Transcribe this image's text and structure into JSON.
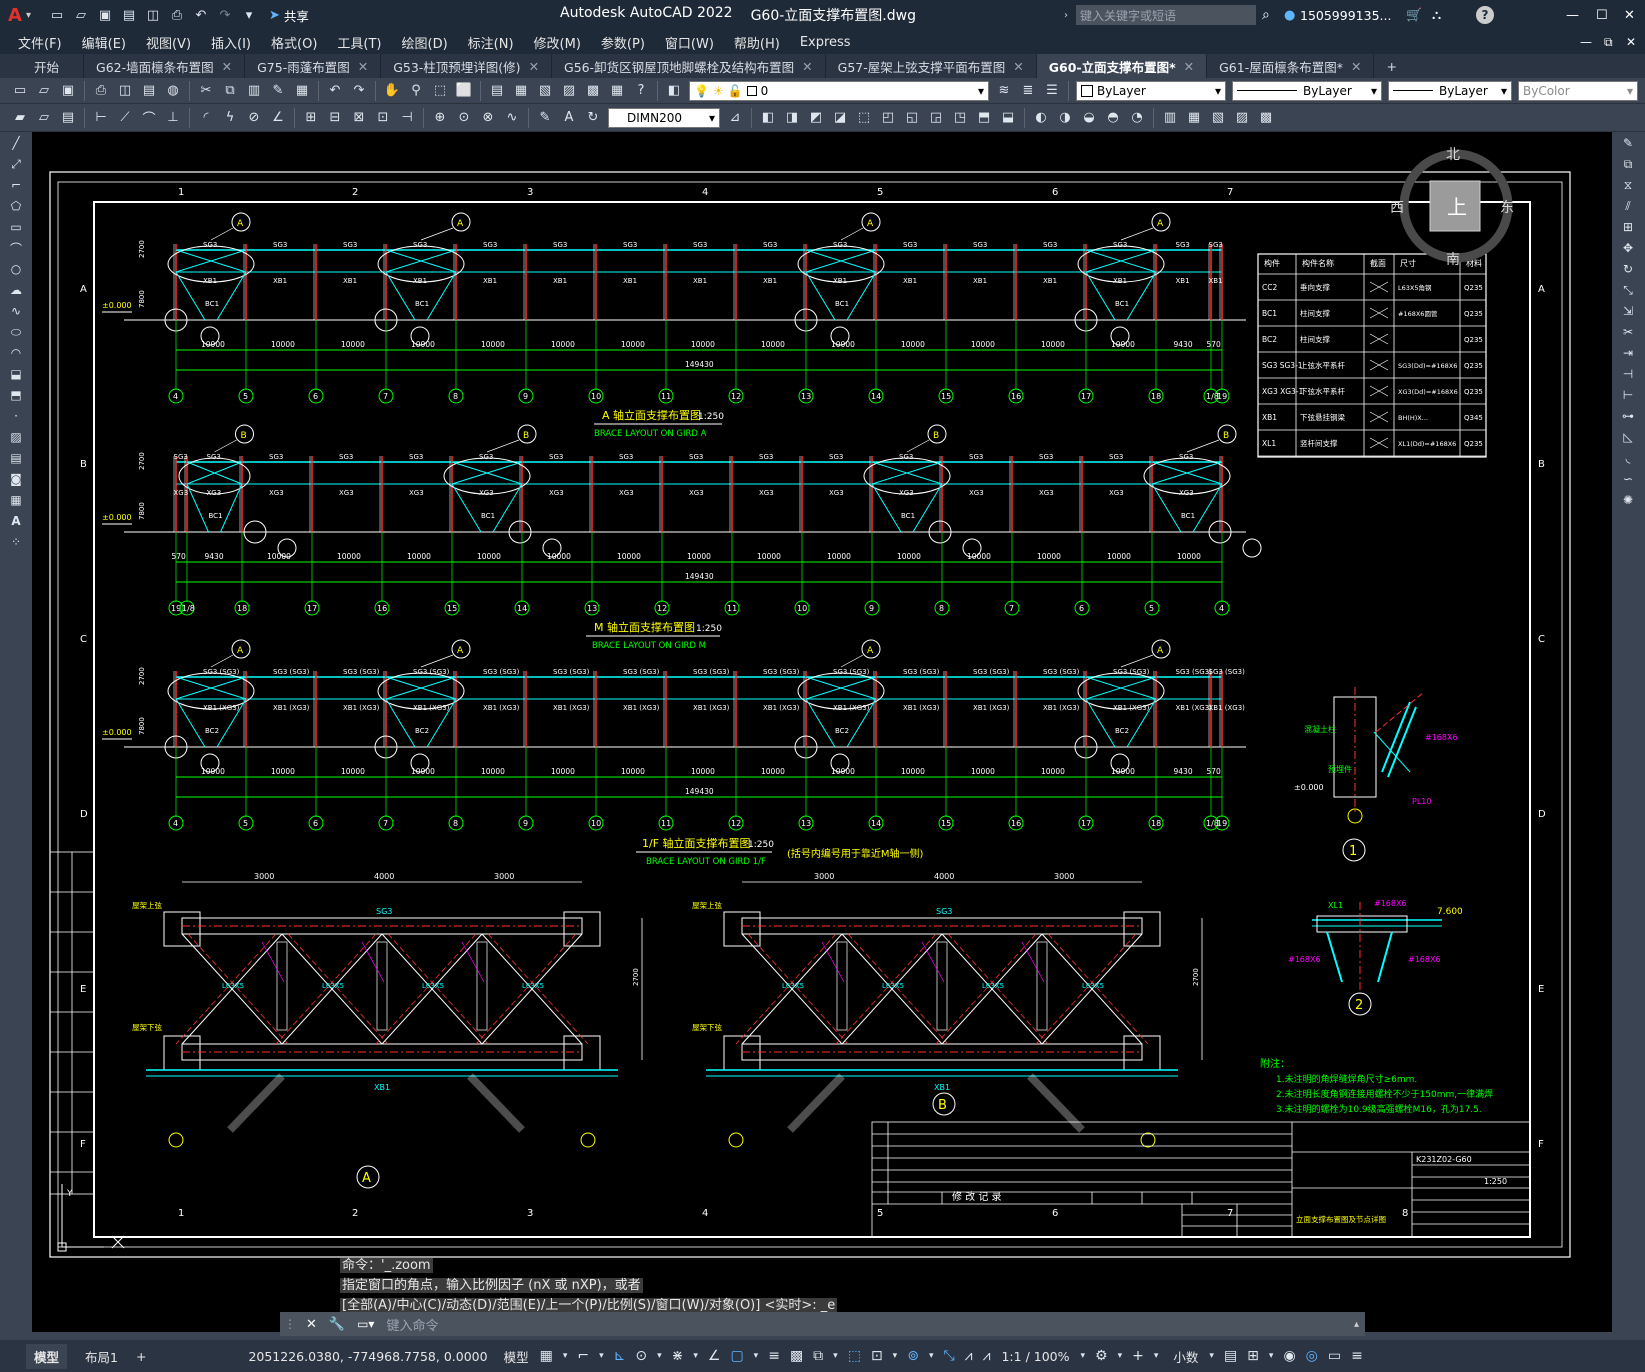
{
  "title_bar": {
    "app_title": "Autodesk AutoCAD 2022",
    "file_name": "G60-立面支撑布置图.dwg",
    "share_label": "共享",
    "search_placeholder": "键入关键字或短语",
    "user": "1505999135...",
    "logo": "A"
  },
  "menu": [
    "文件(F)",
    "编辑(E)",
    "视图(V)",
    "插入(I)",
    "格式(O)",
    "工具(T)",
    "绘图(D)",
    "标注(N)",
    "修改(M)",
    "参数(P)",
    "窗口(W)",
    "帮助(H)",
    "Express"
  ],
  "tabs": [
    {
      "label": "开始"
    },
    {
      "label": "G62-墙面檩条布置图"
    },
    {
      "label": "G75-雨蓬布置图"
    },
    {
      "label": "G53-柱顶预埋详图(修)"
    },
    {
      "label": "G56-卸货区钢屋顶地脚螺栓及结构布置图"
    },
    {
      "label": "G57-屋架上弦支撑平面布置图"
    },
    {
      "label": "G60-立面支撑布置图*"
    },
    {
      "label": "G61-屋面檩条布置图*"
    }
  ],
  "toolbar": {
    "layer_value": "0",
    "color_value": "ByLayer",
    "linetype_value": "ByLayer",
    "lineweight_value": "ByLayer",
    "plotstyle_value": "ByColor",
    "dimstyle_value": "DIMN200"
  },
  "viewcube": {
    "north": "北",
    "south": "南",
    "east": "东",
    "west": "西",
    "face": "上"
  },
  "drawing": {
    "elev_a_title": "A 轴立面支撑布置图",
    "elev_a_sub": "BRACE LAYOUT ON GIRD A",
    "elev_m_title": "M 轴立面支撑布置图",
    "elev_m_sub": "BRACE LAYOUT ON GIRD M",
    "elev_1f_title": "1/F 轴立面支撑布置图",
    "elev_1f_sub": "BRACE LAYOUT ON GIRD 1/F",
    "elev_1f_note": "(括号内编号用于靠近M轴一侧)",
    "scale": "1:250",
    "total_dim": "149430",
    "dim_10000": "10000",
    "dim_9430": "9430",
    "dim_570": "570",
    "level": "±0.000",
    "h2700": "2700",
    "h7800": "7800",
    "level_7600": "7.600",
    "border_cols": [
      "1",
      "2",
      "3",
      "4",
      "5",
      "6",
      "7",
      "8"
    ],
    "border_rows": [
      "A",
      "B",
      "C",
      "D",
      "E",
      "F"
    ],
    "grid_a": [
      "4",
      "5",
      "6",
      "7",
      "8",
      "9",
      "10",
      "11",
      "12",
      "13",
      "14",
      "15",
      "16",
      "17",
      "18",
      "1/8",
      "19"
    ],
    "grid_m": [
      "19",
      "1/8",
      "18",
      "17",
      "16",
      "15",
      "14",
      "13",
      "12",
      "11",
      "10",
      "9",
      "8",
      "7",
      "6",
      "5",
      "4"
    ],
    "detail_a": "A",
    "detail_b": "B",
    "detail_1": "1",
    "detail_2": "2",
    "table_headers": [
      "构件",
      "构件名称",
      "截面",
      "尺寸",
      "材料"
    ],
    "table_rows": [
      [
        "CC2",
        "垂向支撑",
        "L63X5角钢",
        "Q235"
      ],
      [
        "BC1",
        "柱间支撑",
        "#168X6圆管",
        "Q235"
      ],
      [
        "BC2",
        "柱间支撑",
        "",
        "Q235"
      ],
      [
        "SG3 SG3-1",
        "上弦水平系杆",
        "SG3(Dd)=#168X6",
        "Q235"
      ],
      [
        "XG3 XG3-1",
        "下弦水平系杆",
        "XG3(Dd)=#168X6",
        "Q235"
      ],
      [
        "XB1",
        "下弦悬挂钢梁",
        "BH(H)X...",
        "Q345"
      ],
      [
        "XL1",
        "竖杆间支撑",
        "XL1(Dd)=#168X6",
        "Q235"
      ]
    ],
    "notes_title": "附注：",
    "notes": [
      "1.未注明的角焊缝焊角尺寸≥6mm.",
      "2.未注明长度角钢连接用螺栓不少于150mm,一律满焊",
      "3.未注明的螺栓为10.9级高强螺栓M16，孔为17.5."
    ],
    "titleblock_rev": "修  改  记  录",
    "titleblock_no": "K231Z02-G60",
    "titleblock_name": "立面支撑布置图及节点详图",
    "titleblock_scale": "1:250",
    "ucs_label": "Y"
  },
  "command": {
    "history": [
      "命令：'_.zoom",
      "指定窗口的角点，输入比例因子 (nX 或 nXP)，或者",
      "[全部(A)/中心(C)/动态(D)/范围(E)/上一个(P)/比例(S)/窗口(W)/对象(O)] <实时>: _e"
    ],
    "placeholder": "键入命令"
  },
  "status": {
    "layout_tabs": [
      "模型",
      "布局1"
    ],
    "coords": "2051226.0380, -774968.7758, 0.0000",
    "space": "模型",
    "scale": "1:1 / 100%",
    "units": "小数"
  }
}
